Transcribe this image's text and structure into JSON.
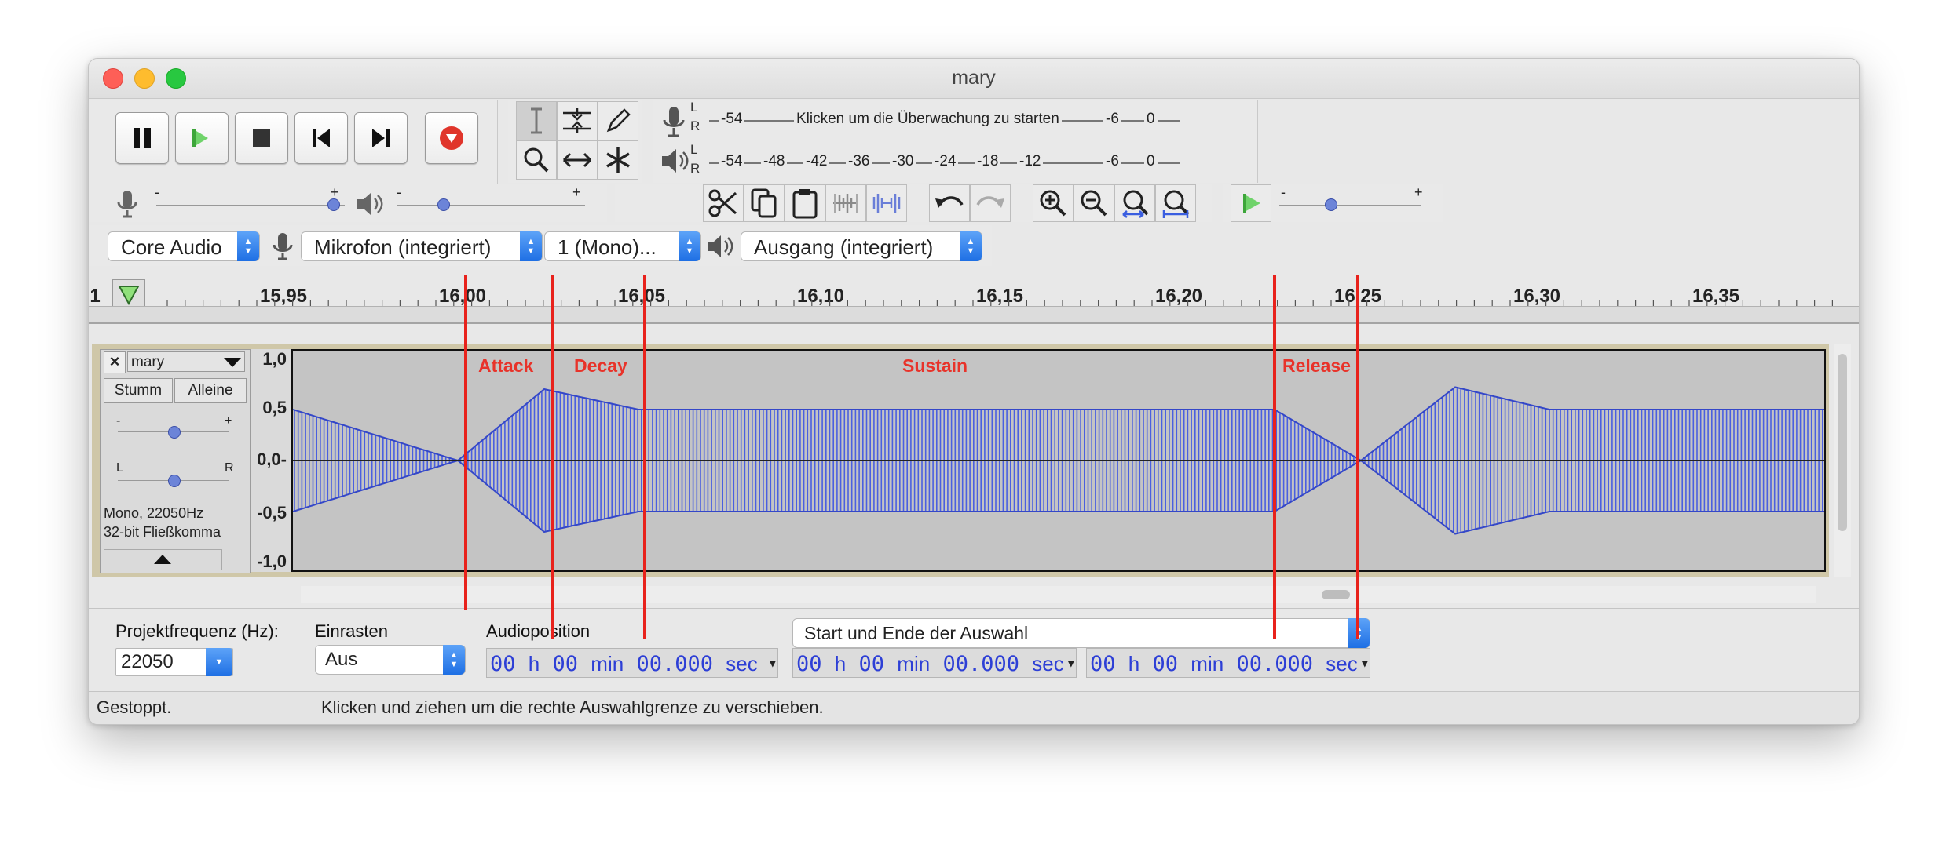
{
  "window": {
    "title": "mary"
  },
  "transport": {
    "buttons": [
      "pause",
      "play",
      "stop",
      "skip-to-start",
      "skip-to-end",
      "record"
    ]
  },
  "meters": {
    "record_scale": [
      "-54",
      "-6",
      "0"
    ],
    "record_prompt": "Klicken um die Überwachung zu starten",
    "playback_scale": [
      "-54",
      "-48",
      "-42",
      "-36",
      "-30",
      "-24",
      "-18",
      "-12",
      "-6",
      "0"
    ],
    "channel_l": "L",
    "channel_r": "R"
  },
  "mixer": {
    "minus": "-",
    "plus": "+"
  },
  "devices": {
    "host": "Core Audio",
    "input": "Mikrofon (integriert)",
    "channels": "1 (Mono)...",
    "output": "Ausgang (integriert)"
  },
  "ruler": {
    "labels": [
      "1",
      "15,95",
      "16,00",
      "16,05",
      "16,10",
      "16,15",
      "16,20",
      "16,25",
      "16,30",
      "16,35"
    ]
  },
  "track": {
    "name": "mary",
    "close": "×",
    "mute": "Stumm",
    "solo": "Alleine",
    "pan_l": "L",
    "pan_r": "R",
    "format_rate": "Mono, 22050Hz",
    "format_bits": "32-bit Fließkomma",
    "vscale": [
      "1,0",
      "0,5",
      "0,0-",
      "-0,5",
      "-1,0"
    ]
  },
  "annotations": {
    "attack": "Attack",
    "decay": "Decay",
    "sustain": "Sustain",
    "release": "Release"
  },
  "selection_bar": {
    "rate_label": "Projektfrequenz (Hz):",
    "rate_value": "22050",
    "snap_label": "Einrasten",
    "snap_value": "Aus",
    "audiopos_label": "Audioposition",
    "range_mode": "Start und Ende der Auswahl",
    "time_h": "00",
    "time_h_unit": "h",
    "time_min": "00",
    "time_min_unit": "min",
    "time_sec": "00.000",
    "time_sec_unit": "sec"
  },
  "status": {
    "state": "Gestoppt.",
    "hint": "Klicken und ziehen um die rechte Auswahlgrenze zu verschieben."
  },
  "colors": {
    "waveform": "#4a5fe0",
    "annotation": "#e8221c",
    "accent": "#1e6fe4"
  }
}
